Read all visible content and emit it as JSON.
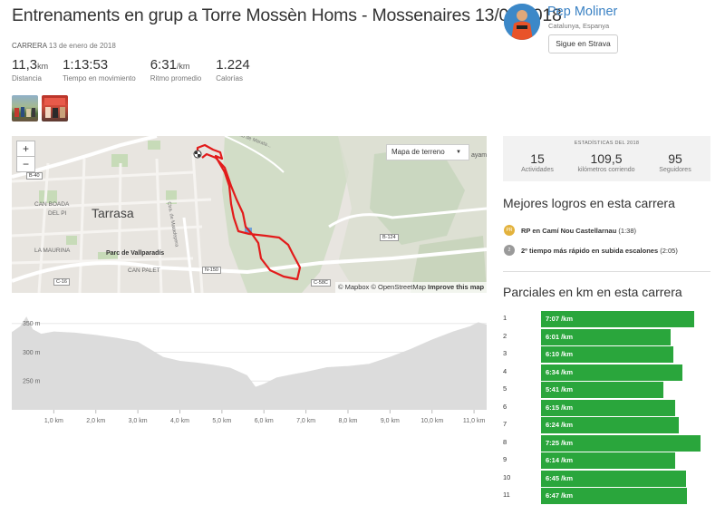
{
  "activity": {
    "title": "Entrenaments en grup a Torre Mossèn Homs - Mossenaires 13/01/2018",
    "type": "CARRERA",
    "date": "13 de enero de 2018",
    "stats": [
      {
        "value": "11,3",
        "unit": "km",
        "label": "Distancia"
      },
      {
        "value": "1:13:53",
        "unit": "",
        "label": "Tiempo en movimiento"
      },
      {
        "value": "6:31",
        "unit": "/km",
        "label": "Ritmo promedio"
      },
      {
        "value": "1.224",
        "unit": "",
        "label": "Calorías"
      }
    ]
  },
  "athlete": {
    "name": "Pep Moliner",
    "location": "Catalunya, Espanya",
    "follow_label": "Sigue en Strava"
  },
  "map": {
    "zoom_in": "+",
    "zoom_out": "−",
    "map_type": "Mapa de terreno",
    "attribution": "© Mapbox © OpenStreetMap",
    "improve": "Improve this map",
    "labels": {
      "city": "Tarrasa",
      "park": "Parc de Vallparadís",
      "can_boada": "CAN BOADA",
      "del_pi": "DEL PI",
      "la_maurina": "LA MAURINA",
      "can_palet": "CAN PALET",
      "b40": "B-40",
      "c16": "C-16",
      "n150": "N-150",
      "b124": "B-124",
      "c58c": "C-58C",
      "ayam": "ayam",
      "marata": "Rio de Marata...",
      "matadepera": "Ctra. de Matadepera"
    }
  },
  "year_stats": {
    "title": "ESTADÍSTICAS DEL 2018",
    "items": [
      {
        "value": "15",
        "label": "Actividades"
      },
      {
        "value": "109,5",
        "label": "kilómetros corriendo"
      },
      {
        "value": "95",
        "label": "Seguidores"
      }
    ]
  },
  "achievements": {
    "title": "Mejores logros en esta carrera",
    "items": [
      {
        "medal": "PR",
        "bold": "RP en Camí Nou Castellarnau",
        "extra": "(1:38)",
        "color": "#e3b23c"
      },
      {
        "medal": "2",
        "bold": "2º tiempo más rápido en subida escalones",
        "extra": "(2:05)",
        "color": "#9a9a9a"
      }
    ]
  },
  "splits": {
    "title": "Parciales en km en esta carrera",
    "unit": "/km",
    "items": [
      {
        "km": "1",
        "pace": "7:07"
      },
      {
        "km": "2",
        "pace": "6:01"
      },
      {
        "km": "3",
        "pace": "6:10"
      },
      {
        "km": "4",
        "pace": "6:34"
      },
      {
        "km": "5",
        "pace": "5:41"
      },
      {
        "km": "6",
        "pace": "6:15"
      },
      {
        "km": "7",
        "pace": "6:24"
      },
      {
        "km": "8",
        "pace": "7:25"
      },
      {
        "km": "9",
        "pace": "6:14"
      },
      {
        "km": "10",
        "pace": "6:45"
      },
      {
        "km": "11",
        "pace": "6:47"
      }
    ]
  },
  "chart_data": {
    "type": "area",
    "title": "",
    "xlabel": "",
    "ylabel": "",
    "x_unit": "km",
    "y_unit": "m",
    "ylim": [
      200,
      370
    ],
    "xlim": [
      0,
      11.3
    ],
    "y_ticks": [
      {
        "v": 250,
        "label": "250 m"
      },
      {
        "v": 300,
        "label": "300 m"
      },
      {
        "v": 350,
        "label": "350 m"
      }
    ],
    "x_ticks": [
      {
        "v": 1,
        "label": "1,0 km"
      },
      {
        "v": 2,
        "label": "2,0 km"
      },
      {
        "v": 3,
        "label": "3,0 km"
      },
      {
        "v": 4,
        "label": "4,0 km"
      },
      {
        "v": 5,
        "label": "5,0 km"
      },
      {
        "v": 6,
        "label": "6,0 km"
      },
      {
        "v": 7,
        "label": "7,0 km"
      },
      {
        "v": 8,
        "label": "8,0 km"
      },
      {
        "v": 9,
        "label": "9,0 km"
      },
      {
        "v": 10,
        "label": "10,0 km"
      },
      {
        "v": 11,
        "label": "11,0 km"
      }
    ],
    "x": [
      0,
      0.2,
      0.35,
      0.5,
      0.7,
      1.0,
      1.5,
      2.0,
      2.5,
      3.0,
      3.3,
      3.6,
      4.0,
      4.4,
      4.8,
      5.2,
      5.6,
      5.8,
      6.0,
      6.3,
      6.7,
      7.0,
      7.5,
      8.0,
      8.5,
      9.0,
      9.5,
      10.0,
      10.5,
      10.9,
      11.1,
      11.3
    ],
    "values": [
      335,
      345,
      362,
      340,
      332,
      336,
      334,
      330,
      325,
      318,
      305,
      292,
      285,
      282,
      278,
      273,
      260,
      240,
      245,
      256,
      262,
      266,
      274,
      276,
      280,
      292,
      306,
      322,
      336,
      345,
      352,
      348
    ]
  }
}
